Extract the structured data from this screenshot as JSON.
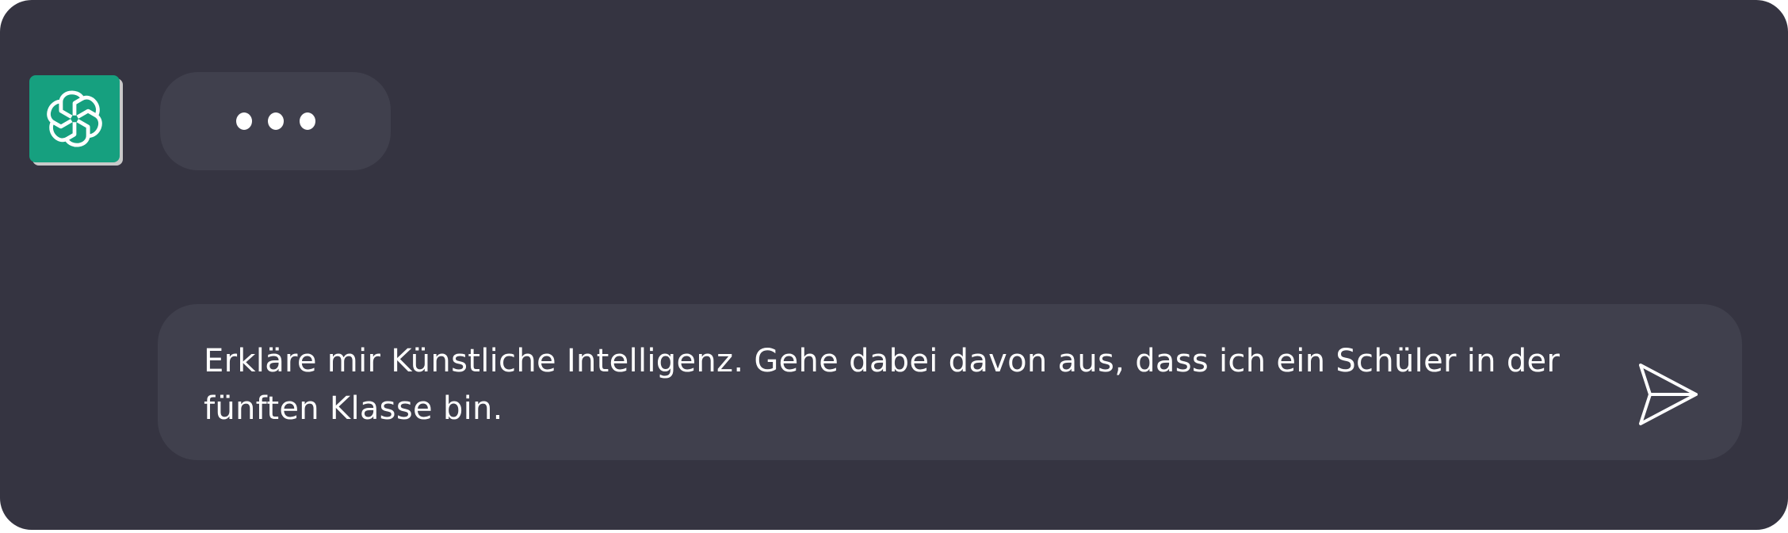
{
  "chat": {
    "assistant": {
      "avatar_icon": "openai-logo-icon",
      "avatar_color": "#16a07f",
      "typing_indicator": "typing-dots-icon"
    },
    "input": {
      "value": "Erkläre mir Künstliche Intelligenz. Gehe dabei davon aus, dass ich ein Schüler in der fünften Klasse bin.",
      "send_icon": "send-icon"
    },
    "colors": {
      "background": "#353441",
      "bubble": "#40404d",
      "text": "#ffffff"
    }
  }
}
